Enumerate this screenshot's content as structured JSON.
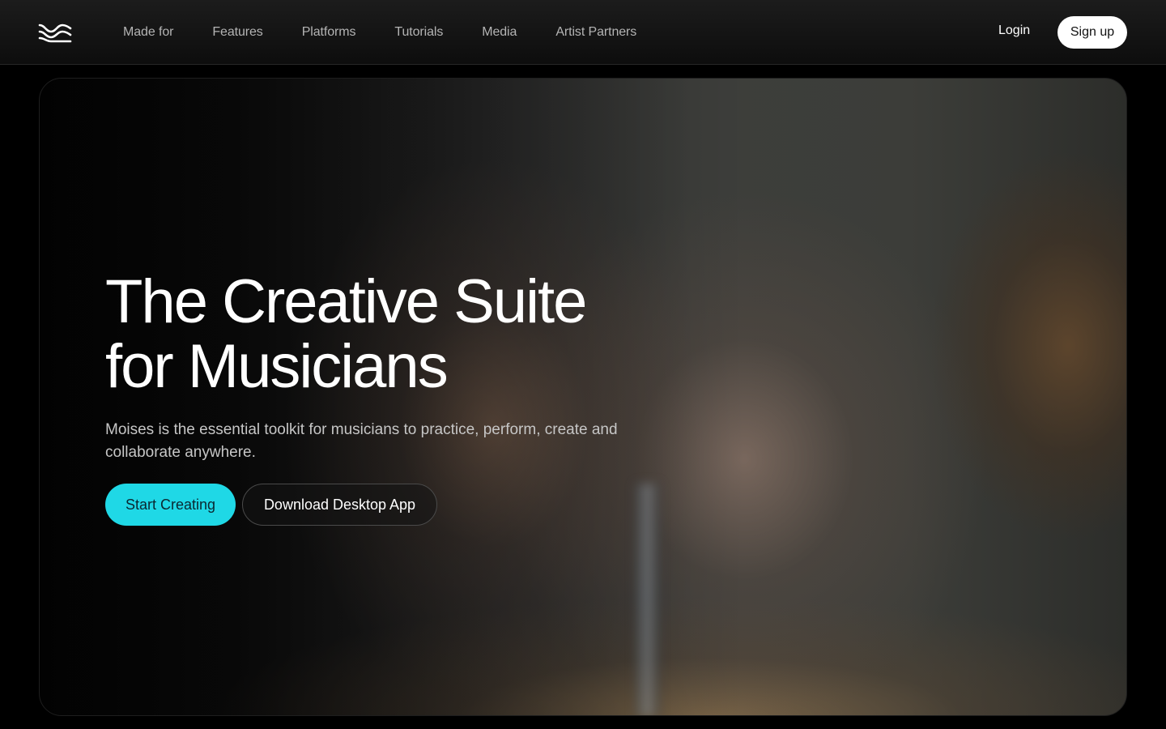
{
  "nav": {
    "logo": "moises-logo-icon",
    "links": [
      "Made for",
      "Features",
      "Platforms",
      "Tutorials",
      "Media",
      "Artist Partners"
    ],
    "login_label": "Login",
    "signup_label": "Sign up"
  },
  "hero": {
    "title_line1": "The Creative Suite",
    "title_line2": "for Musicians",
    "subtitle": "Moises is the essential toolkit for musicians to practice, perform, create and collaborate anywhere.",
    "primary_cta": "Start Creating",
    "secondary_cta": "Download Desktop App"
  },
  "colors": {
    "accent": "#1fd8e6",
    "background": "#000000"
  }
}
